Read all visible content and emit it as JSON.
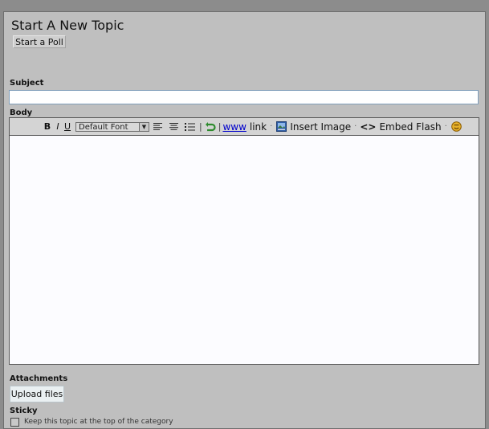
{
  "page": {
    "title": "Start A New Topic",
    "poll_button": "Start a Poll"
  },
  "form": {
    "subject_label": "Subject",
    "subject_value": "",
    "body_label": "Body",
    "attachments_label": "Attachments",
    "upload_button": "Upload files",
    "sticky_label": "Sticky",
    "sticky_description": "Keep this topic at the top of the category",
    "sticky_checked": false
  },
  "toolbar": {
    "bold": "B",
    "italic": "I",
    "underline": "U",
    "font_select": "Default Font",
    "www": "www",
    "link": "link",
    "insert_image": "Insert Image",
    "embed_flash_glyph": "<>",
    "embed_flash": "Embed Flash",
    "separator": "|",
    "dot": "·"
  },
  "icons": {
    "align_left": "align-left-icon",
    "align_center": "align-center-icon",
    "bullet_list": "bullet-list-icon",
    "undo": "undo-icon",
    "image": "image-icon",
    "emoticon": "emoticon-icon"
  },
  "colors": {
    "panel_bg": "#bfbfbf",
    "outer_bg": "#8c8c8c",
    "link": "#0000cc",
    "undo_green": "#2e8b2e",
    "emoticon_gold": "#d49a1a"
  }
}
